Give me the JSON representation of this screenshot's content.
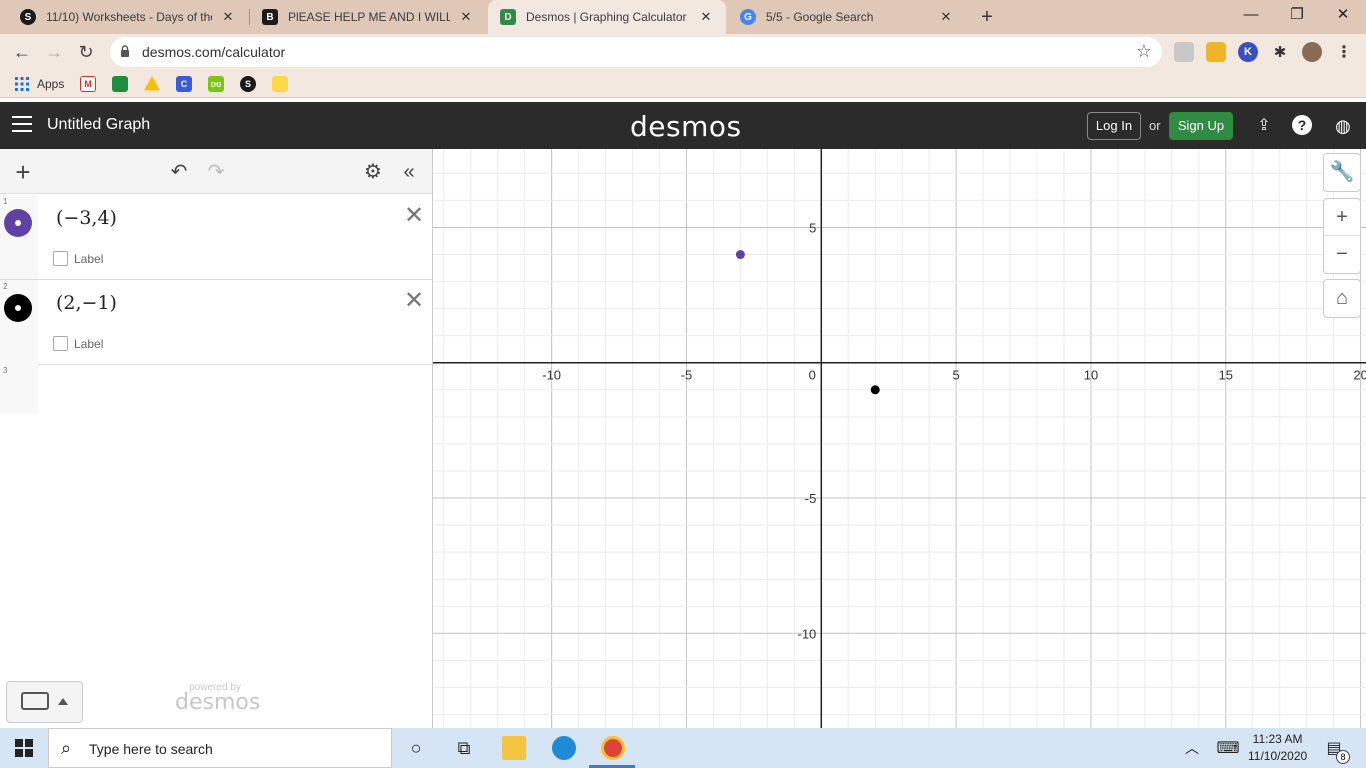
{
  "browser": {
    "tabs": [
      {
        "title": "11/10) Worksheets - Days of the",
        "icon": "S",
        "icon_color": "#1a1a1a",
        "active": false
      },
      {
        "title": "PlEASE HELP ME AND I WILL GIVE",
        "icon": "B",
        "icon_color": "#1a1a1a",
        "active": false
      },
      {
        "title": "Desmos | Graphing Calculator",
        "icon": "D",
        "icon_color": "#2f8c42",
        "active": true
      },
      {
        "title": "5/5 - Google Search",
        "icon": "G",
        "icon_color": "#4285f4",
        "active": false
      }
    ],
    "url": "desmos.com/calculator",
    "bookmarks_apps_label": "Apps"
  },
  "desmos": {
    "graph_title": "Untitled Graph",
    "logo": "desmos",
    "login_label": "Log In",
    "or_label": "or",
    "signup_label": "Sign Up",
    "expressions": [
      {
        "index": "1",
        "latex": "(−3,4)",
        "color": "#6042a6",
        "label_text": "Label"
      },
      {
        "index": "2",
        "latex": "(2,−1)",
        "color": "#000000",
        "label_text": "Label"
      }
    ],
    "empty_index": "3",
    "powered_by": "powered by",
    "powered_logo": "desmos"
  },
  "chart_data": {
    "type": "scatter",
    "xlim": [
      -14.4,
      20.2
    ],
    "ylim": [
      -13.5,
      7.9
    ],
    "x_major_ticks": [
      -10,
      -5,
      0,
      5,
      10,
      15,
      20
    ],
    "y_major_ticks": [
      5,
      -5,
      -10
    ],
    "x_tick_labels": [
      "-10",
      "-5",
      "0",
      "5",
      "10",
      "15",
      "20"
    ],
    "y_tick_labels": [
      "5",
      "-5",
      "-10"
    ],
    "minor_step": 1,
    "grid": true,
    "points": [
      {
        "x": -3,
        "y": 4,
        "color": "#6042a6"
      },
      {
        "x": 2,
        "y": -1,
        "color": "#000000"
      }
    ]
  },
  "taskbar": {
    "search_placeholder": "Type here to search",
    "time": "11:23 AM",
    "date": "11/10/2020",
    "notification_count": "8"
  }
}
